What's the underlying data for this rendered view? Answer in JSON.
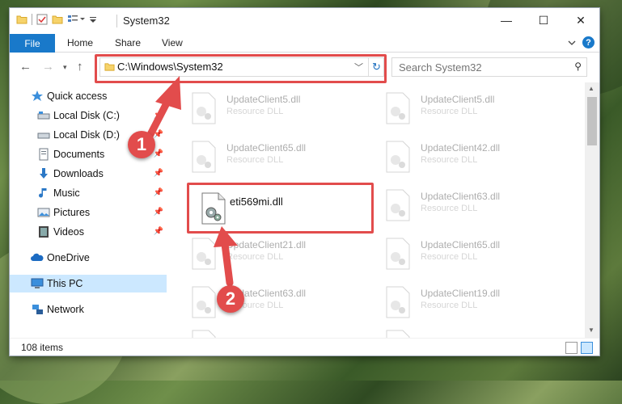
{
  "window": {
    "title": "System32",
    "controls": {
      "minimize": "—",
      "maximize": "☐",
      "close": "✕"
    }
  },
  "ribbon": {
    "tabs": [
      "File",
      "Home",
      "Share",
      "View"
    ],
    "help_label": "?"
  },
  "navigation": {
    "address": "C:\\Windows\\System32",
    "search_placeholder": "Search System32"
  },
  "nav_pane": {
    "items": [
      {
        "label": "Quick access",
        "icon": "star-icon"
      },
      {
        "label": "Local Disk (C:)",
        "icon": "drive-icon",
        "pinned": true
      },
      {
        "label": "Local Disk (D:)",
        "icon": "drive-icon",
        "pinned": true
      },
      {
        "label": "Documents",
        "icon": "documents-icon",
        "pinned": true
      },
      {
        "label": "Downloads",
        "icon": "download-icon",
        "pinned": true
      },
      {
        "label": "Music",
        "icon": "music-icon",
        "pinned": true
      },
      {
        "label": "Pictures",
        "icon": "pictures-icon",
        "pinned": true
      },
      {
        "label": "Videos",
        "icon": "videos-icon",
        "pinned": true
      },
      {
        "label": "OneDrive",
        "icon": "cloud-icon"
      },
      {
        "label": "This PC",
        "icon": "pc-icon",
        "selected": true
      },
      {
        "label": "Network",
        "icon": "network-icon"
      }
    ]
  },
  "files": [
    {
      "name": "UpdateClient5.dll",
      "desc": "Resource DLL"
    },
    {
      "name": "UpdateClient5.dll",
      "desc": "Resource DLL"
    },
    {
      "name": "UpdateClient65.dll",
      "desc": "Resource DLL"
    },
    {
      "name": "UpdateClient42.dll",
      "desc": "Resource DLL"
    },
    {
      "name": "eti569mi.dll",
      "desc": "",
      "highlighted": true
    },
    {
      "name": "UpdateClient63.dll",
      "desc": "Resource DLL"
    },
    {
      "name": "UpdateClient21.dll",
      "desc": "Resource DLL"
    },
    {
      "name": "UpdateClient65.dll",
      "desc": "Resource DLL"
    },
    {
      "name": "UpdateClient63.dll",
      "desc": "Resource DLL"
    },
    {
      "name": "UpdateClient19.dll",
      "desc": "Resource DLL"
    },
    {
      "name": "",
      "desc": ""
    },
    {
      "name": "",
      "desc": ""
    }
  ],
  "status_bar": {
    "item_count": "108 items"
  },
  "annotations": {
    "step1": "1",
    "step2": "2",
    "color": "#e24c4c"
  }
}
